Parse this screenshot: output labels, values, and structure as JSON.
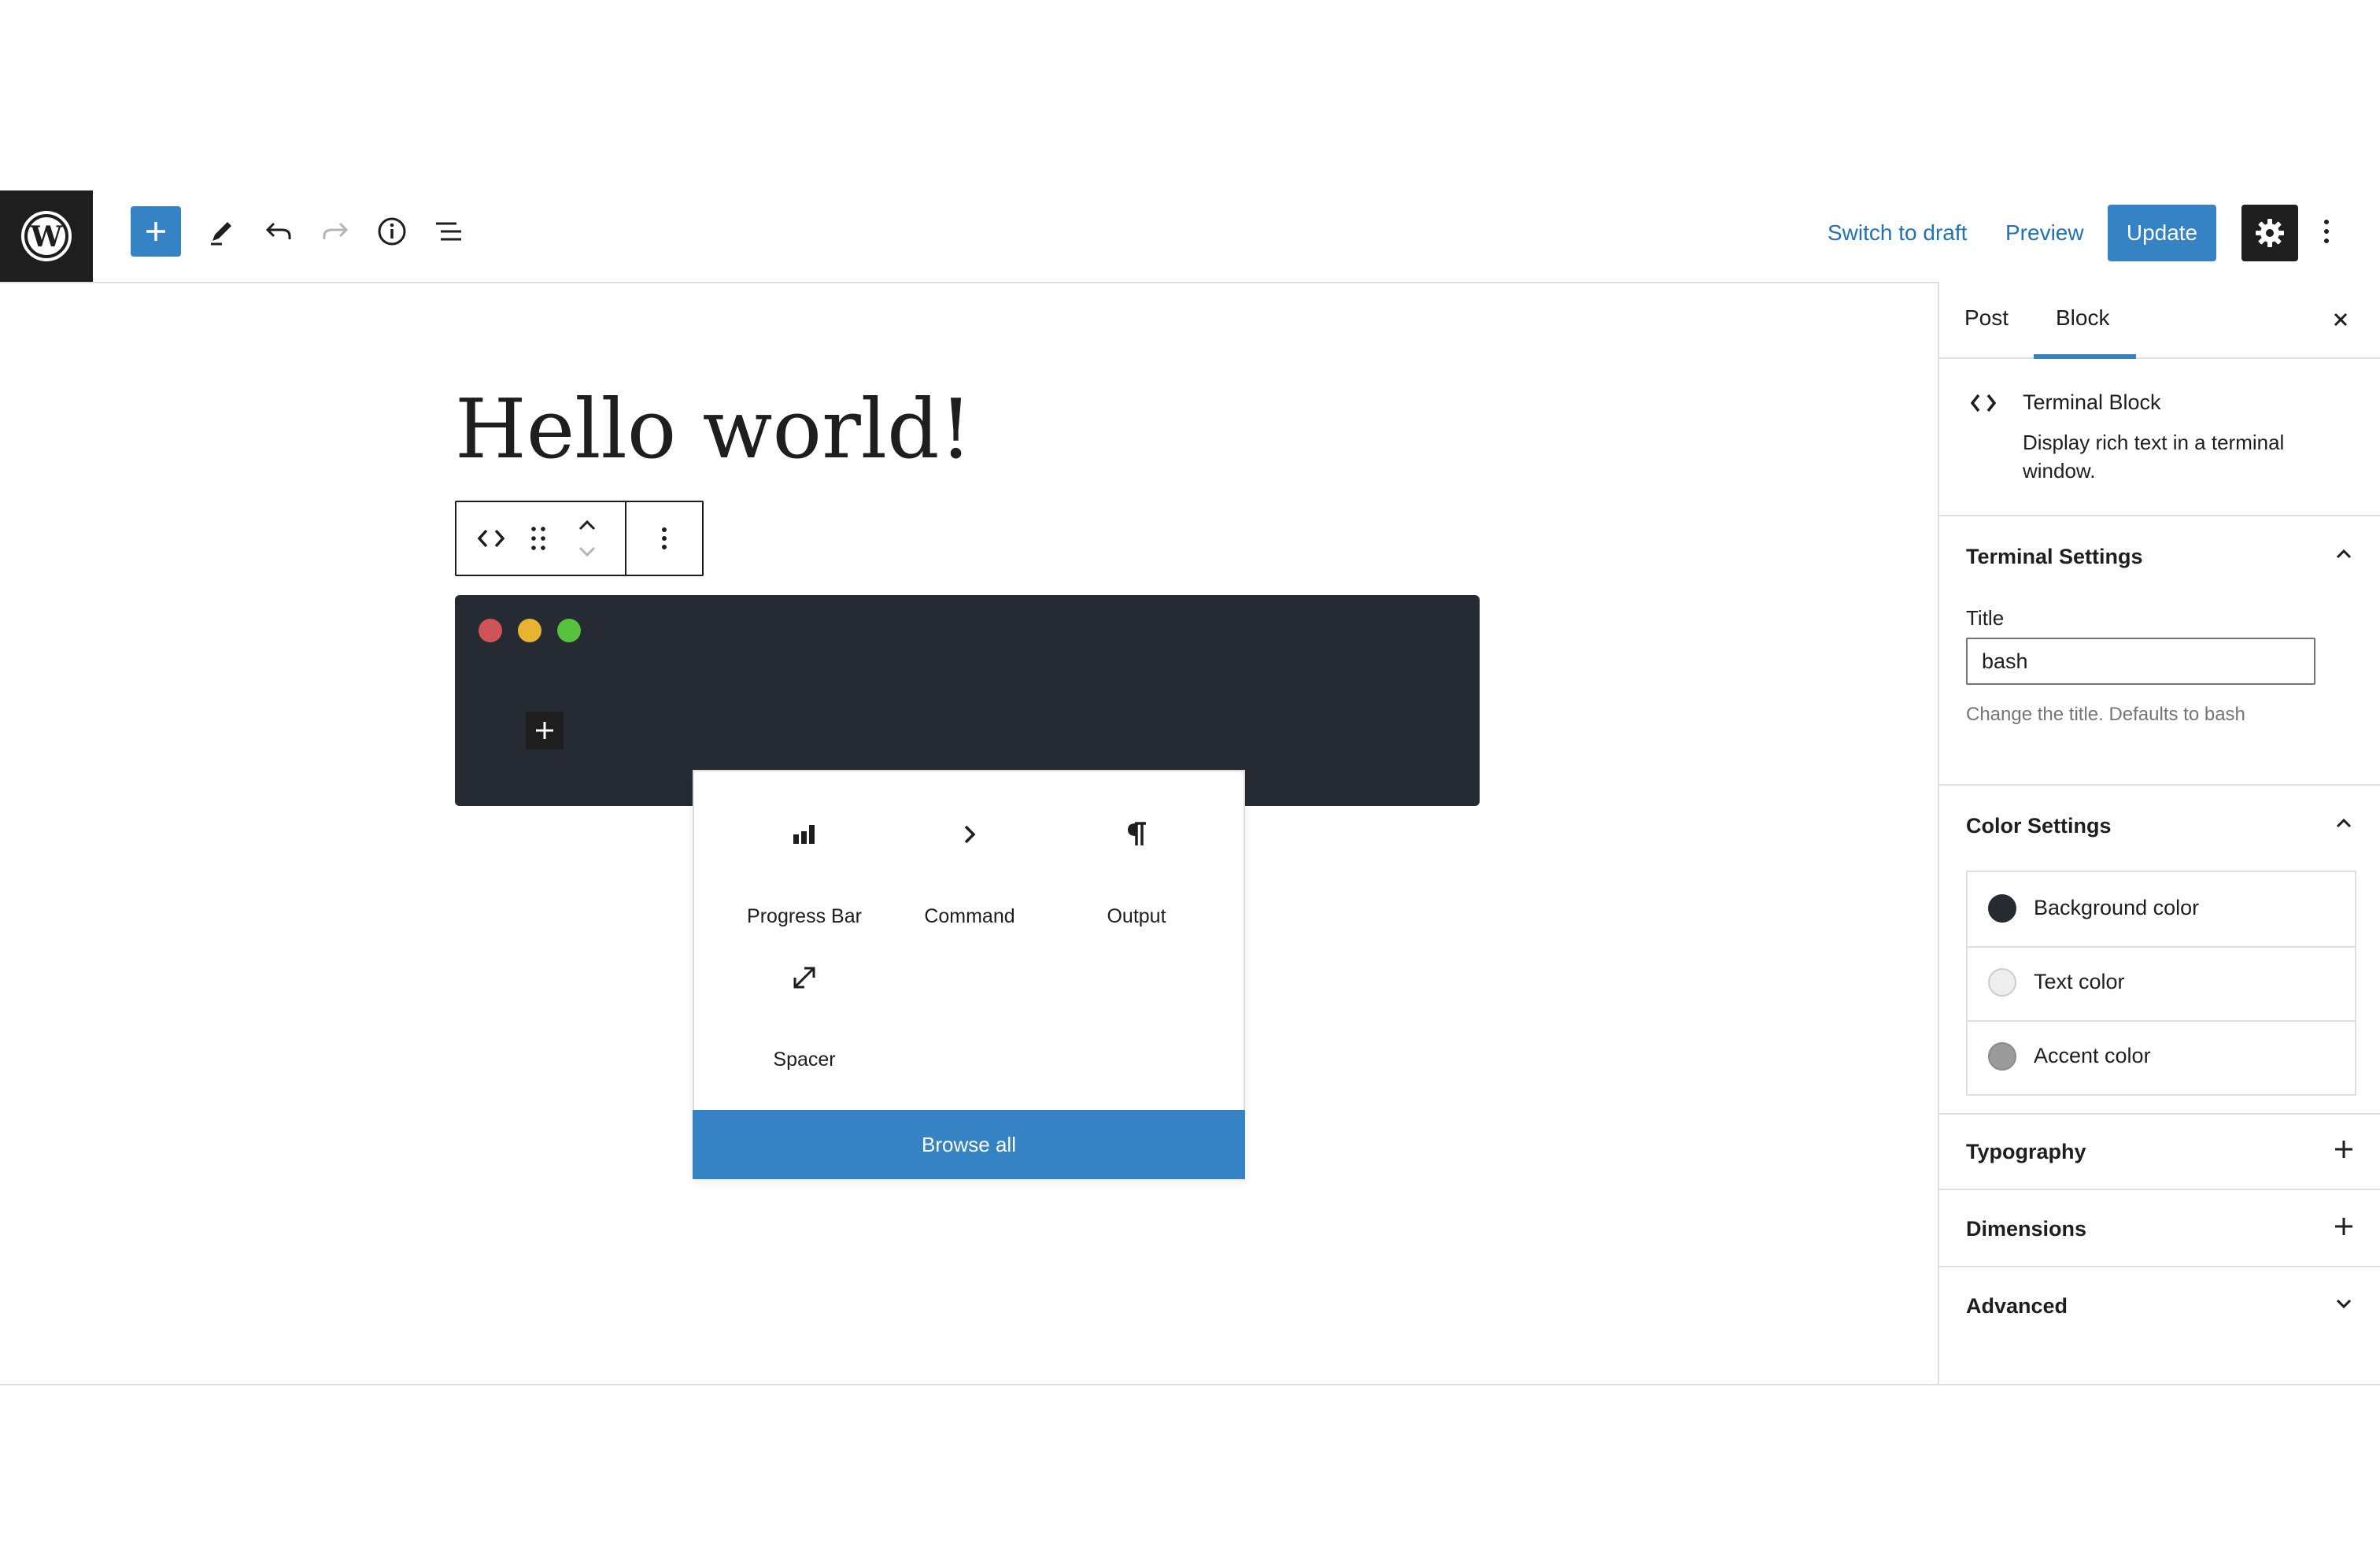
{
  "toolbar": {
    "switch_to_draft": "Switch to draft",
    "preview": "Preview",
    "update": "Update"
  },
  "post": {
    "title": "Hello world!"
  },
  "terminal": {
    "dot_colors": [
      "#d0535a",
      "#e8b42f",
      "#56c23b"
    ],
    "background": "#262b33"
  },
  "inserter": {
    "items": [
      {
        "label": "Progress Bar",
        "icon": "bar-chart-icon"
      },
      {
        "label": "Command",
        "icon": "chevron-right-icon"
      },
      {
        "label": "Output",
        "icon": "pilcrow-icon"
      },
      {
        "label": "Spacer",
        "icon": "resize-arrows-icon"
      }
    ],
    "browse_all": "Browse all"
  },
  "sidebar": {
    "tabs": [
      {
        "label": "Post",
        "active": false
      },
      {
        "label": "Block",
        "active": true
      }
    ],
    "block_card": {
      "name": "Terminal Block",
      "description": "Display rich text in a terminal window."
    },
    "terminal_settings": {
      "title": "Terminal Settings",
      "field_label": "Title",
      "field_value": "bash",
      "help": "Change the title. Defaults to bash"
    },
    "color_settings": {
      "title": "Color Settings",
      "items": [
        {
          "label": "Background color",
          "color": "#262b33"
        },
        {
          "label": "Text color",
          "color": "#eeeeee"
        },
        {
          "label": "Accent color",
          "color": "#9b9b9b"
        }
      ]
    },
    "panels": [
      {
        "title": "Typography"
      },
      {
        "title": "Dimensions"
      },
      {
        "title": "Advanced"
      }
    ]
  }
}
